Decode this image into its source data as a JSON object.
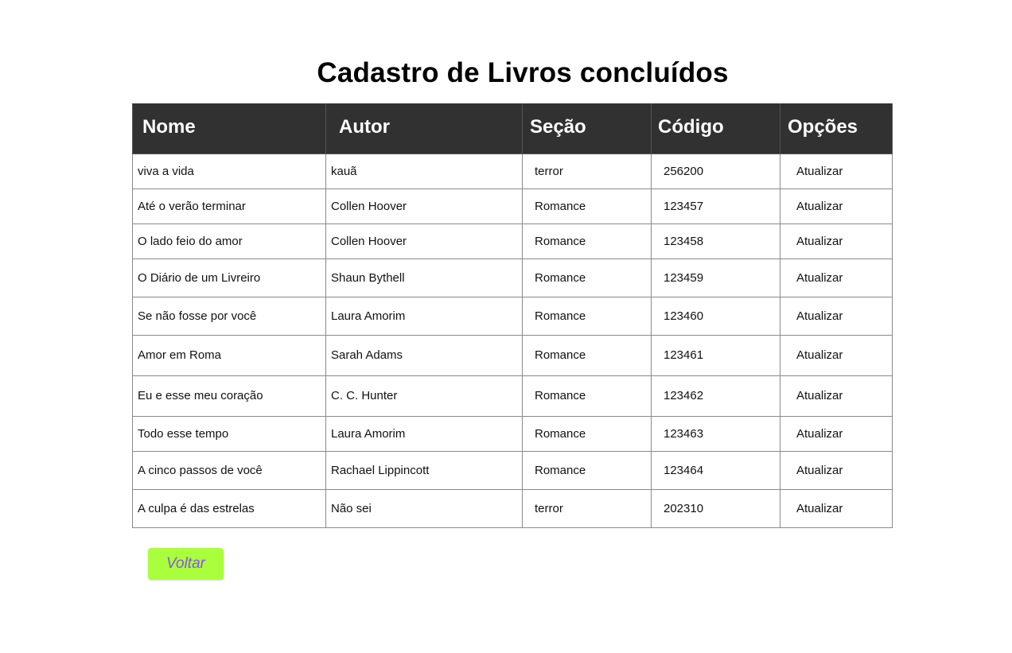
{
  "page": {
    "title": "Cadastro de Livros concluídos"
  },
  "table": {
    "headers": {
      "nome": "Nome",
      "autor": "Autor",
      "secao": "Seção",
      "codigo": "Código",
      "opcoes": "Opções"
    },
    "rows": [
      {
        "nome": "viva a vida",
        "autor": "kauã",
        "secao": "terror",
        "codigo": "256200",
        "acao": "Atualizar"
      },
      {
        "nome": "Até o verão terminar",
        "autor": "Collen Hoover",
        "secao": "Romance",
        "codigo": "123457",
        "acao": "Atualizar"
      },
      {
        "nome": "O lado feio do amor",
        "autor": "Collen Hoover",
        "secao": "Romance",
        "codigo": "123458",
        "acao": "Atualizar"
      },
      {
        "nome": "O Diário de um Livreiro",
        "autor": "Shaun Bythell",
        "secao": "Romance",
        "codigo": "123459",
        "acao": "Atualizar"
      },
      {
        "nome": "Se não fosse por você",
        "autor": "Laura Amorim",
        "secao": "Romance",
        "codigo": "123460",
        "acao": "Atualizar"
      },
      {
        "nome": "Amor em Roma",
        "autor": "Sarah Adams",
        "secao": "Romance",
        "codigo": "123461",
        "acao": "Atualizar"
      },
      {
        "nome": "Eu e esse meu coração",
        "autor": "C. C. Hunter",
        "secao": "Romance",
        "codigo": "123462",
        "acao": "Atualizar"
      },
      {
        "nome": "Todo esse tempo",
        "autor": "Laura Amorim",
        "secao": "Romance",
        "codigo": "123463",
        "acao": "Atualizar"
      },
      {
        "nome": "A cinco passos de você",
        "autor": "Rachael Lippincott",
        "secao": "Romance",
        "codigo": "123464",
        "acao": "Atualizar"
      },
      {
        "nome": "A culpa é das estrelas",
        "autor": "Não sei",
        "secao": "terror",
        "codigo": "202310",
        "acao": "Atualizar"
      }
    ]
  },
  "actions": {
    "back_label": "Voltar"
  },
  "colors": {
    "header_bg": "#313131",
    "back_button_bg": "#aaff3d",
    "back_button_text": "#8a55e0"
  }
}
